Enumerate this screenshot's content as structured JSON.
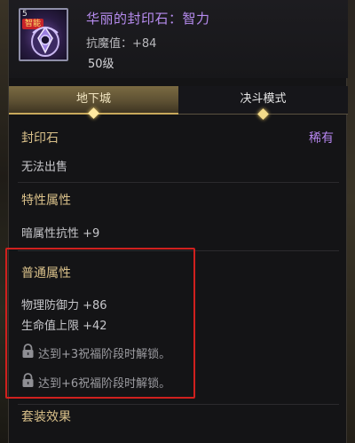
{
  "item": {
    "corner_number": "5",
    "tag": "智能",
    "name": "华丽的封印石：智力",
    "stat": "抗魔值：+84",
    "level": "50级"
  },
  "tabs": [
    {
      "label": "地下城",
      "active": true
    },
    {
      "label": "决斗模式",
      "active": false
    }
  ],
  "seal": {
    "title": "封印石",
    "rarity": "稀有",
    "trade": "无法出售"
  },
  "special_attrs": {
    "title": "特性属性",
    "lines": [
      "暗属性抗性 +9"
    ]
  },
  "normal_attrs": {
    "title": "普通属性",
    "lines": [
      "物理防御力 +86",
      "生命值上限 +42"
    ],
    "locked": [
      "达到+3祝福阶段时解锁。",
      "达到+6祝福阶段时解锁。"
    ]
  },
  "set_effect": {
    "title": "套装效果"
  },
  "colors": {
    "title_purple": "#b78cf0",
    "rarity_purple": "#b585ee",
    "section_gold": "#d9c08a",
    "highlight_red": "#d0201e"
  },
  "icons": [
    "seal-stone-icon",
    "lock-icon"
  ]
}
